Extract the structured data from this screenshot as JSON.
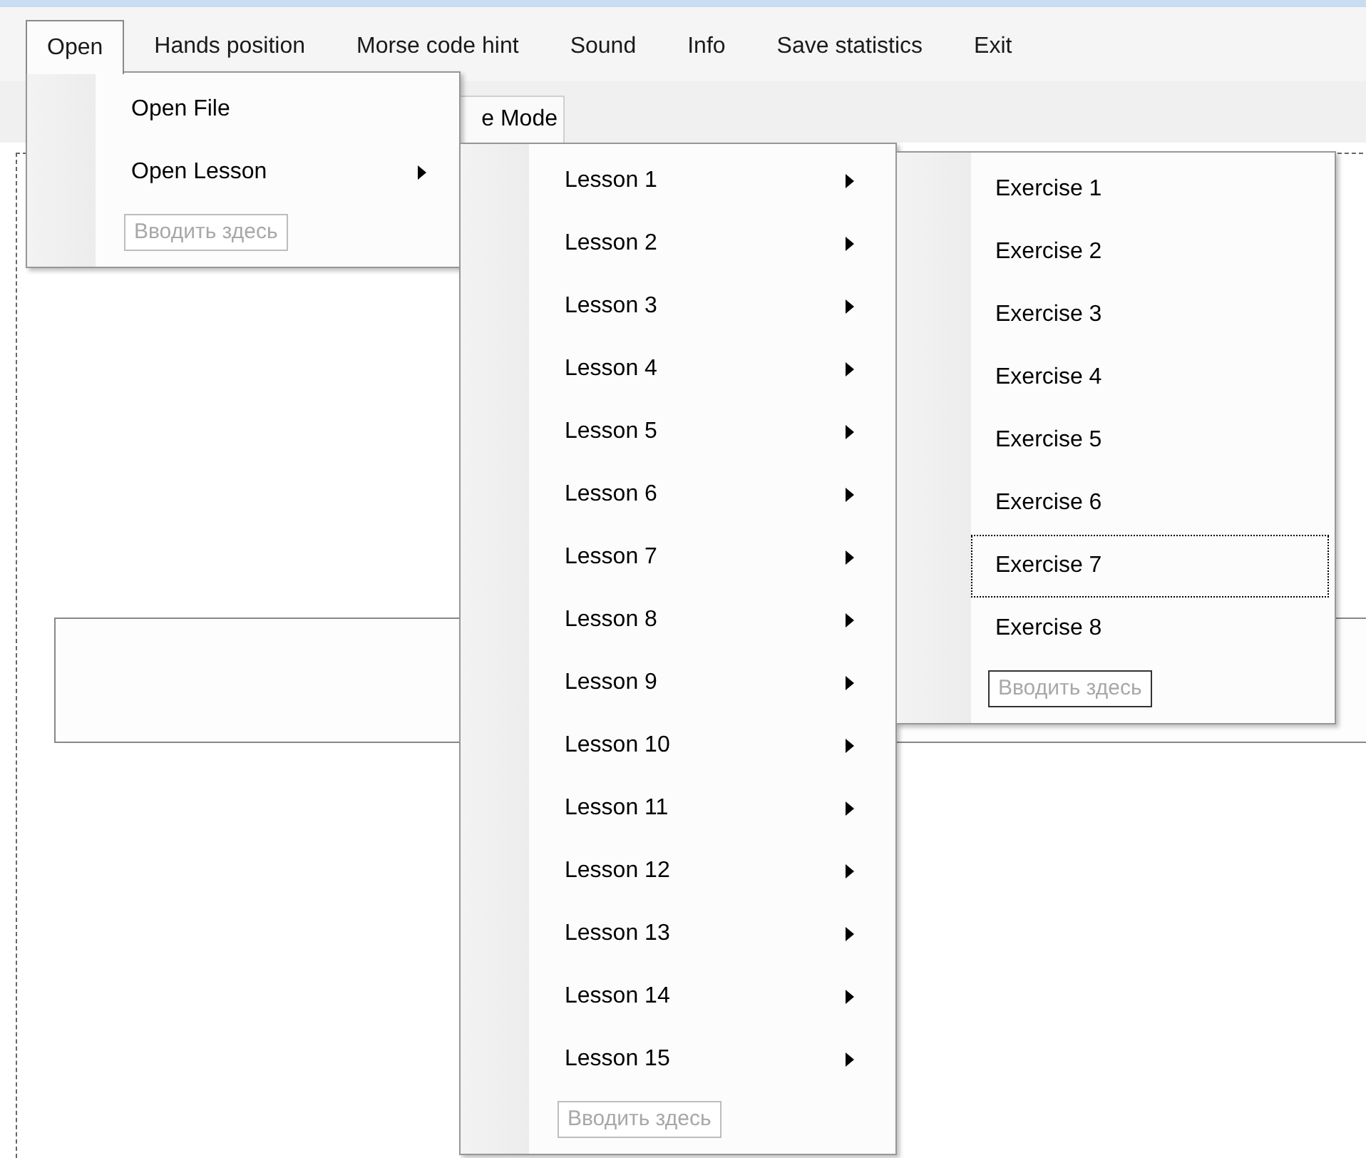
{
  "menu_bar": [
    {
      "label": "Open",
      "selected": true
    },
    {
      "label": "Hands position",
      "selected": false
    },
    {
      "label": "Morse code hint",
      "selected": false
    },
    {
      "label": "Sound",
      "selected": false
    },
    {
      "label": "Info",
      "selected": false
    },
    {
      "label": "Save statistics",
      "selected": false
    },
    {
      "label": "Exit",
      "selected": false
    }
  ],
  "tab": {
    "label": "e Mode"
  },
  "open_menu": {
    "items": [
      {
        "label": "Open File",
        "submenu": false,
        "focused": false
      },
      {
        "label": "Open Lesson",
        "submenu": true,
        "focused": false
      }
    ],
    "placeholder": {
      "label": "Вводить здесь",
      "active": false
    }
  },
  "lesson_menu": {
    "items": [
      {
        "label": "Lesson 1",
        "submenu": true,
        "focused": false
      },
      {
        "label": "Lesson 2",
        "submenu": true,
        "focused": false
      },
      {
        "label": "Lesson 3",
        "submenu": true,
        "focused": false
      },
      {
        "label": "Lesson 4",
        "submenu": true,
        "focused": false
      },
      {
        "label": "Lesson 5",
        "submenu": true,
        "focused": false
      },
      {
        "label": "Lesson 6",
        "submenu": true,
        "focused": false
      },
      {
        "label": "Lesson 7",
        "submenu": true,
        "focused": false
      },
      {
        "label": "Lesson 8",
        "submenu": true,
        "focused": false
      },
      {
        "label": "Lesson 9",
        "submenu": true,
        "focused": false
      },
      {
        "label": "Lesson 10",
        "submenu": true,
        "focused": false
      },
      {
        "label": "Lesson 11",
        "submenu": true,
        "focused": false
      },
      {
        "label": "Lesson 12",
        "submenu": true,
        "focused": false
      },
      {
        "label": "Lesson 13",
        "submenu": true,
        "focused": false
      },
      {
        "label": "Lesson 14",
        "submenu": true,
        "focused": false
      },
      {
        "label": "Lesson 15",
        "submenu": true,
        "focused": false
      }
    ],
    "placeholder": {
      "label": "Вводить здесь",
      "active": false
    }
  },
  "exercise_menu": {
    "items": [
      {
        "label": "Exercise 1",
        "submenu": false,
        "focused": false
      },
      {
        "label": "Exercise 2",
        "submenu": false,
        "focused": false
      },
      {
        "label": "Exercise 3",
        "submenu": false,
        "focused": false
      },
      {
        "label": "Exercise 4",
        "submenu": false,
        "focused": false
      },
      {
        "label": "Exercise 5",
        "submenu": false,
        "focused": false
      },
      {
        "label": "Exercise 6",
        "submenu": false,
        "focused": false
      },
      {
        "label": "Exercise 7",
        "submenu": false,
        "focused": true
      },
      {
        "label": "Exercise 8",
        "submenu": false,
        "focused": false
      }
    ],
    "placeholder": {
      "label": "Вводить здесь",
      "active": true
    }
  }
}
